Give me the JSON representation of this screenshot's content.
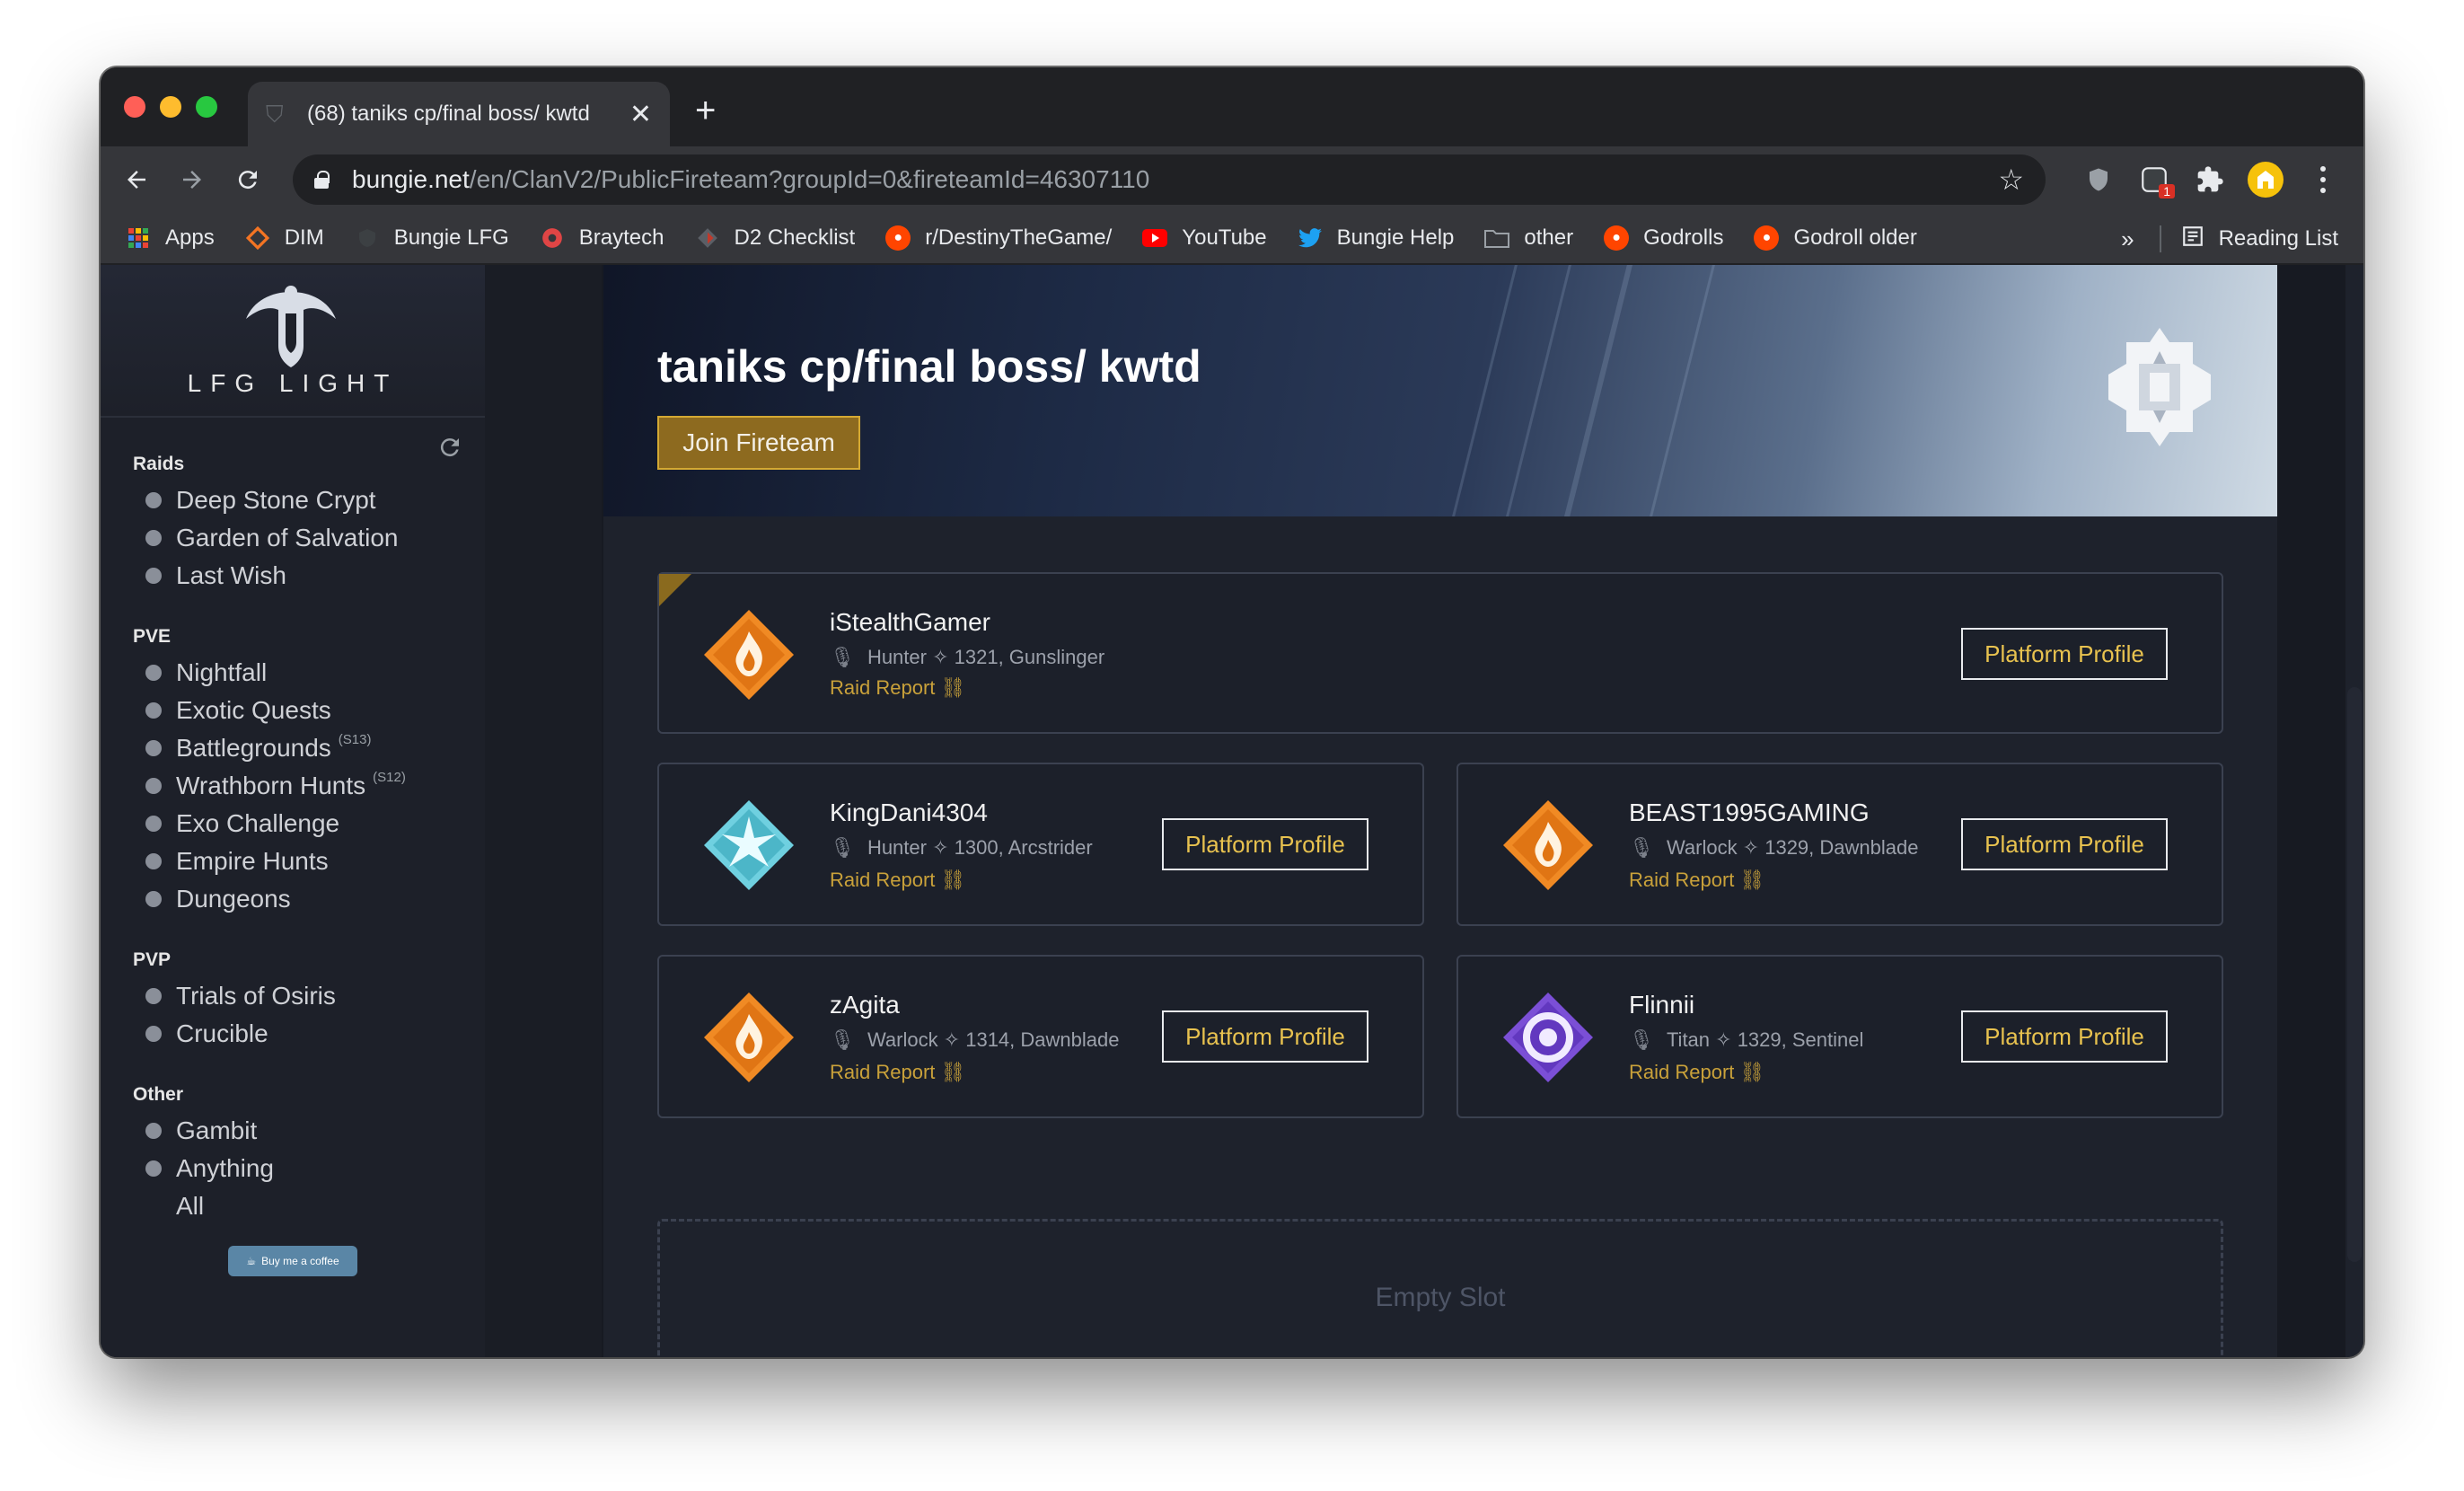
{
  "tab": {
    "title": "(68) taniks cp/final boss/ kwtd",
    "close": "✕",
    "new_tab": "+"
  },
  "toolbar": {
    "url_host": "bungie.net",
    "url_path": "/en/ClanV2/PublicFireteam?groupId=0&fireteamId=46307110",
    "extension_badge": "1"
  },
  "bookmarks": {
    "items": [
      {
        "label": "Apps",
        "icon": "apps-grid-icon",
        "color": "#ea4335"
      },
      {
        "label": "DIM",
        "icon": "dim-icon",
        "color": "#f37423"
      },
      {
        "label": "Bungie LFG",
        "icon": "bungie-icon",
        "color": "#3c4043"
      },
      {
        "label": "Braytech",
        "icon": "braytech-icon",
        "color": "#e04545"
      },
      {
        "label": "D2 Checklist",
        "icon": "d2checklist-icon",
        "color": "#c0392b"
      },
      {
        "label": "r/DestinyTheGame/",
        "icon": "reddit-icon",
        "color": "#ff4500"
      },
      {
        "label": "YouTube",
        "icon": "youtube-icon",
        "color": "#ff0000"
      },
      {
        "label": "Bungie Help",
        "icon": "twitter-icon",
        "color": "#1da1f2"
      },
      {
        "label": "other",
        "icon": "folder-icon",
        "color": "#9aa0a6"
      },
      {
        "label": "Godrolls",
        "icon": "reddit-icon",
        "color": "#ff4500"
      },
      {
        "label": "Godroll older",
        "icon": "reddit-icon",
        "color": "#ff4500"
      }
    ],
    "overflow": "»",
    "reading_list": "Reading List"
  },
  "sidebar": {
    "logo_text": "LFG LIGHT",
    "sections": [
      {
        "title": "Raids",
        "items": [
          {
            "label": "Deep Stone Crypt"
          },
          {
            "label": "Garden of Salvation"
          },
          {
            "label": "Last Wish"
          }
        ]
      },
      {
        "title": "PVE",
        "items": [
          {
            "label": "Nightfall"
          },
          {
            "label": "Exotic Quests"
          },
          {
            "label": "Battlegrounds",
            "tag": "(S13)"
          },
          {
            "label": "Wrathborn Hunts",
            "tag": "(S12)"
          },
          {
            "label": "Exo Challenge"
          },
          {
            "label": "Empire Hunts"
          },
          {
            "label": "Dungeons"
          }
        ]
      },
      {
        "title": "PVP",
        "items": [
          {
            "label": "Trials of Osiris"
          },
          {
            "label": "Crucible"
          }
        ]
      },
      {
        "title": "Other",
        "items": [
          {
            "label": "Gambit"
          },
          {
            "label": "Anything"
          },
          {
            "label": "All"
          }
        ]
      }
    ],
    "coffee_label": "Buy me a coffee"
  },
  "fireteam": {
    "title": "taniks cp/final boss/ kwtd",
    "join_label": "Join Fireteam",
    "members": [
      {
        "name": "iStealthGamer",
        "class": "Hunter",
        "power": "1321",
        "subclass": "Gunslinger",
        "info": "Hunter ✧ 1321, Gunslinger",
        "emblem_color": "#f08a24"
      },
      {
        "name": "KingDani4304",
        "class": "Hunter",
        "power": "1300",
        "subclass": "Arcstrider",
        "info": "Hunter ✧ 1300, Arcstrider",
        "emblem_color": "#6fd0e0"
      },
      {
        "name": "BEAST1995GAMING",
        "class": "Warlock",
        "power": "1329",
        "subclass": "Dawnblade",
        "info": "Warlock ✧ 1329, Dawnblade",
        "emblem_color": "#f08a24"
      },
      {
        "name": "zAgita",
        "class": "Warlock",
        "power": "1314",
        "subclass": "Dawnblade",
        "info": "Warlock ✧ 1314, Dawnblade",
        "emblem_color": "#f08a24"
      },
      {
        "name": "Flinnii",
        "class": "Titan",
        "power": "1329",
        "subclass": "Sentinel",
        "info": "Titan ✧ 1329, Sentinel",
        "emblem_color": "#7b4fd6"
      }
    ],
    "raid_report_label": "Raid Report",
    "platform_profile_label": "Platform Profile",
    "empty_slot_label": "Empty Slot"
  }
}
